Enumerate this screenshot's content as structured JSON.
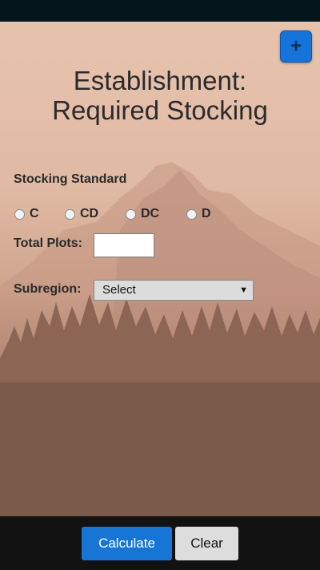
{
  "toolbar": {
    "add_icon": "+"
  },
  "page": {
    "title_line1": "Establishment:",
    "title_line2": "Required Stocking"
  },
  "stocking": {
    "label": "Stocking Standard",
    "options": [
      "C",
      "CD",
      "DC",
      "D"
    ]
  },
  "plots": {
    "label": "Total Plots:",
    "value": ""
  },
  "subregion": {
    "label": "Subregion:",
    "selected": "Select"
  },
  "footer": {
    "calculate_label": "Calculate",
    "clear_label": "Clear"
  },
  "colors": {
    "accent": "#1775d6",
    "footer_bg": "#121212",
    "status_bar": "#04151c"
  }
}
